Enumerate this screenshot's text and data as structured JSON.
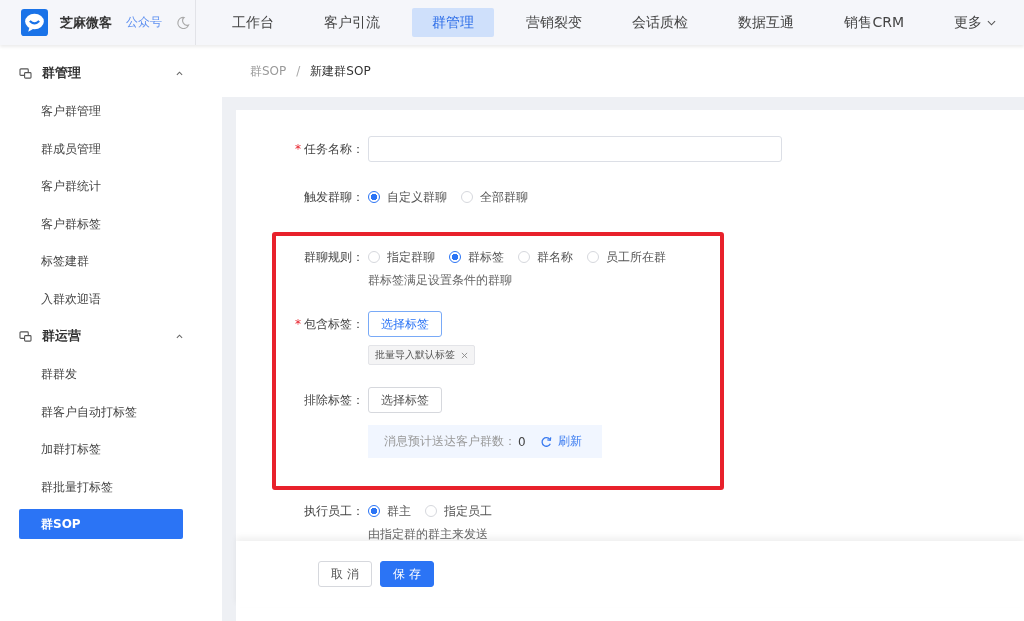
{
  "header": {
    "brand": "芝麻微客",
    "account_link": "公众号",
    "nav": [
      {
        "label": "工作台",
        "selected": false
      },
      {
        "label": "客户引流",
        "selected": false
      },
      {
        "label": "群管理",
        "selected": true
      },
      {
        "label": "营销裂变",
        "selected": false
      },
      {
        "label": "会话质检",
        "selected": false
      },
      {
        "label": "数据互通",
        "selected": false
      },
      {
        "label": "销售CRM",
        "selected": false
      }
    ],
    "more": "更多"
  },
  "sidebar": [
    {
      "title": "群管理",
      "expanded": true,
      "items": [
        {
          "label": "客户群管理",
          "selected": false
        },
        {
          "label": "群成员管理",
          "selected": false
        },
        {
          "label": "客户群统计",
          "selected": false
        },
        {
          "label": "客户群标签",
          "selected": false
        },
        {
          "label": "标签建群",
          "selected": false
        },
        {
          "label": "入群欢迎语",
          "selected": false
        }
      ]
    },
    {
      "title": "群运营",
      "expanded": true,
      "items": [
        {
          "label": "群群发",
          "selected": false
        },
        {
          "label": "群客户自动打标签",
          "selected": false
        },
        {
          "label": "加群打标签",
          "selected": false
        },
        {
          "label": "群批量打标签",
          "selected": false
        },
        {
          "label": "群SOP",
          "selected": true
        }
      ]
    }
  ],
  "breadcrumb": [
    "群SOP",
    "新建群SOP"
  ],
  "breadcrumb_separator": "/",
  "required_mark": "*",
  "form": [
    {
      "highlighted": false,
      "rows": [
        {
          "kind": "input",
          "label": "任务名称：",
          "required": true
        },
        {
          "kind": "radio",
          "label": "触发群聊：",
          "required": false,
          "options": [
            {
              "label": "自定义群聊",
              "selected": true
            },
            {
              "label": "全部群聊",
              "selected": false
            }
          ]
        }
      ]
    },
    {
      "highlighted": true,
      "rows": [
        {
          "kind": "radio",
          "label": "群聊规则：",
          "required": false,
          "options": [
            {
              "label": "指定群聊",
              "selected": false
            },
            {
              "label": "群标签",
              "selected": true
            },
            {
              "label": "群名称",
              "selected": false
            },
            {
              "label": "员工所在群",
              "selected": false
            }
          ],
          "hint": "群标签满足设置条件的群聊"
        },
        {
          "kind": "tags",
          "label": "包含标签：",
          "required": true,
          "button": "选择标签",
          "tags": [
            {
              "label": "批量导入默认标签"
            }
          ]
        },
        {
          "kind": "tags",
          "label": "排除标签：",
          "required": false,
          "button": "选择标签",
          "estimate": {
            "label": "消息预计送达客户群数：",
            "count": "0",
            "action": "刷新"
          }
        }
      ]
    },
    {
      "highlighted": false,
      "rows": [
        {
          "kind": "radio",
          "label": "执行员工：",
          "required": false,
          "options": [
            {
              "label": "群主",
              "selected": true
            },
            {
              "label": "指定员工",
              "selected": false
            }
          ],
          "hint": "由指定群的群主来发送"
        }
      ]
    }
  ],
  "footer": [
    {
      "label": "取 消",
      "kind": "default"
    },
    {
      "label": "保 存",
      "kind": "primary"
    }
  ]
}
